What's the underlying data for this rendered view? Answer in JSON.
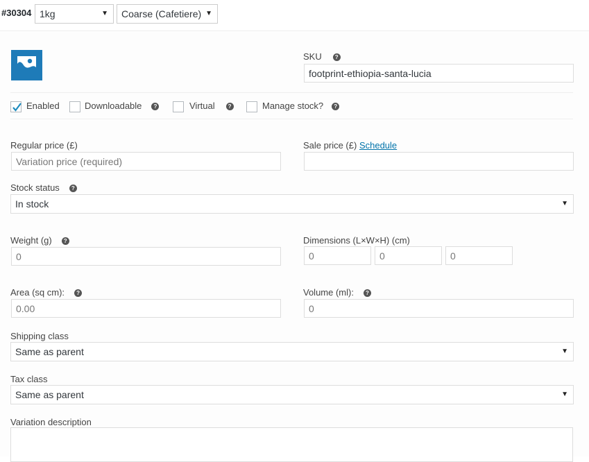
{
  "header": {
    "variation_id": "#30304",
    "weight_select": "1kg",
    "grind_select": "Coarse (Cafetiere)"
  },
  "sku": {
    "label": "SKU",
    "value": "footprint-ethiopia-santa-lucia"
  },
  "options": {
    "enabled": {
      "label": "Enabled",
      "checked": true
    },
    "downloadable": {
      "label": "Downloadable",
      "checked": false
    },
    "virtual": {
      "label": "Virtual",
      "checked": false
    },
    "manage_stock": {
      "label": "Manage stock?",
      "checked": false
    }
  },
  "pricing": {
    "regular_label": "Regular price (£)",
    "regular_placeholder": "Variation price (required)",
    "sale_label": "Sale price (£)",
    "schedule_link": "Schedule",
    "sale_value": ""
  },
  "stock": {
    "label": "Stock status",
    "value": "In stock"
  },
  "weight": {
    "label": "Weight (g)",
    "placeholder": "0"
  },
  "dimensions": {
    "label": "Dimensions (L×W×H) (cm)",
    "length": "0",
    "width": "0",
    "height": "0"
  },
  "area": {
    "label": "Area (sq cm):",
    "placeholder": "0.00"
  },
  "volume": {
    "label": "Volume (ml):",
    "placeholder": "0"
  },
  "shipping": {
    "label": "Shipping class",
    "value": "Same as parent"
  },
  "tax": {
    "label": "Tax class",
    "value": "Same as parent"
  },
  "description": {
    "label": "Variation description",
    "value": ""
  },
  "icons": {
    "help": "?",
    "caret": "▼"
  },
  "colors": {
    "accent": "#1e7bb8",
    "link": "#0073aa",
    "check": "#1e8cbe"
  }
}
